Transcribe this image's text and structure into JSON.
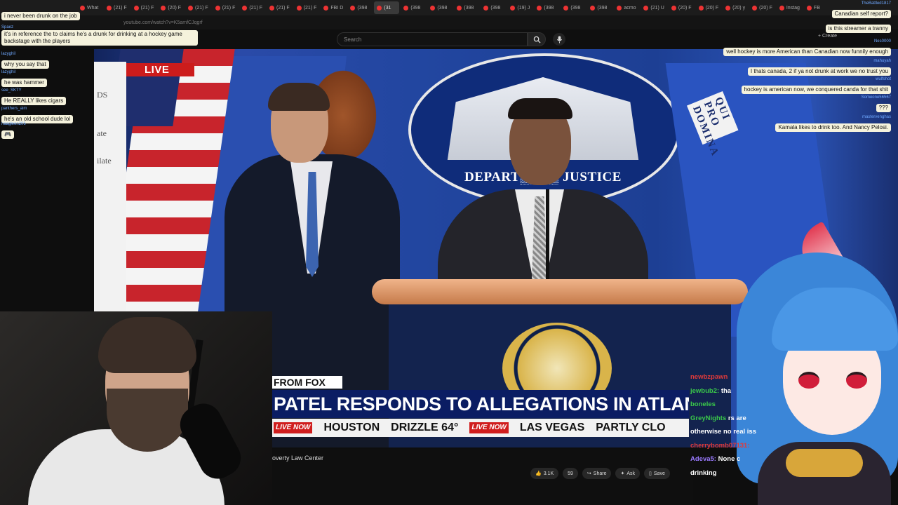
{
  "browser": {
    "tabs": [
      {
        "label": "What"
      },
      {
        "label": "(21) F"
      },
      {
        "label": "(21) F"
      },
      {
        "label": "(20) F"
      },
      {
        "label": "(21) F"
      },
      {
        "label": "(21) F"
      },
      {
        "label": "(21) F"
      },
      {
        "label": "(21) F"
      },
      {
        "label": "(21) F"
      },
      {
        "label": "FBI D"
      },
      {
        "label": "(398"
      },
      {
        "label": "(31"
      },
      {
        "label": "(398"
      },
      {
        "label": "(398"
      },
      {
        "label": "(398"
      },
      {
        "label": "(398"
      },
      {
        "label": "(19) J"
      },
      {
        "label": "(398"
      },
      {
        "label": "(398"
      },
      {
        "label": "(398"
      },
      {
        "label": "acmo"
      },
      {
        "label": "(21) U"
      },
      {
        "label": "(20) F"
      },
      {
        "label": "(20) F"
      },
      {
        "label": "(20) y"
      },
      {
        "label": "(20) F"
      },
      {
        "label": "Instag"
      },
      {
        "label": "FB"
      }
    ],
    "active_tab_index": 11,
    "url": "youtube.com/watch?v=K5amfCJqgrf"
  },
  "youtube": {
    "search_placeholder": "Search",
    "create_label": "Create",
    "channel_text": "overty Law Center",
    "likes": "3.1K",
    "comments": "59",
    "share": "Share",
    "ask": "Ask",
    "save": "Save"
  },
  "video": {
    "live_label": "LIVE",
    "seal_text": "DEPARTMENT OF JUSTICE",
    "seal_text_visible": "DEPART▒▒▒▒ JUSTICE",
    "motto": "QUI PRO DOMINA",
    "fox_tag": "FROM FOX",
    "headline": "PATEL RESPONDS TO ALLEGATIONS IN ATLANTIC",
    "ticker": [
      {
        "badge": "LIVE NOW",
        "text": "HOUSTON"
      },
      {
        "badge": "",
        "text": "DRIZZLE 64°"
      },
      {
        "badge": "LIVE NOW",
        "text": "LAS VEGAS"
      },
      {
        "badge": "",
        "text": "PARTLY CLO"
      }
    ],
    "paper_lines": [
      "DS",
      "ate",
      "ilate"
    ]
  },
  "chat_left": [
    {
      "name": "",
      "text": "i never been drunk on the job"
    },
    {
      "name": "Spaez",
      "text": "it's in reference the to claims he's a drunk for drinking at a hockey game backstage with the players"
    },
    {
      "name": "lazyghil",
      "text": "why you say that"
    },
    {
      "name": "lazyghil",
      "text": "he was hammer"
    },
    {
      "name": "see_SKTY",
      "text": "He REALLY likes cigars"
    },
    {
      "name": "panthers_aim",
      "text": "he's an old school dude lol"
    },
    {
      "name": "naagleen206",
      "text": "🎮"
    }
  ],
  "chat_right": [
    {
      "name": "TheBattled1817",
      "text": "Canadian self report?"
    },
    {
      "name": "",
      "text": "is this streamer a tranny"
    },
    {
      "name": "Nes0000",
      "text": "well hockey is more American than Canadian now funnily enough"
    },
    {
      "name": "mahuyah",
      "text": "I thats canada, 2 if ya not drunk at work we no trust you"
    },
    {
      "name": "wulfshot",
      "text": "hockey is american now, we conquered canda for that shit"
    },
    {
      "name": "Someone56567",
      "text": "???"
    },
    {
      "name": "mastervenghas",
      "text": "Kamala likes to drink too. And Nancy Pelosi."
    }
  ],
  "chat_overlay": [
    {
      "name": "newbzpawn",
      "text": "",
      "color": "#e03a3a"
    },
    {
      "name": "jewbub2:",
      "text": "tha",
      "color": "#3ac84a"
    },
    {
      "name": "boneles",
      "text": "",
      "color": "#3ac84a"
    },
    {
      "name": "GreyNights",
      "text": "rs are",
      "color": "#3ac84a"
    },
    {
      "name": "",
      "text": "otherwise no real iss",
      "color": "#ffffff"
    },
    {
      "name": "cherrybomb07131:",
      "text": "",
      "color": "#e03a3a"
    },
    {
      "name": "Adeva5:",
      "text": "None c",
      "color": "#9a7aff"
    },
    {
      "name": "",
      "text": "drinking",
      "color": "#ffffff"
    }
  ]
}
